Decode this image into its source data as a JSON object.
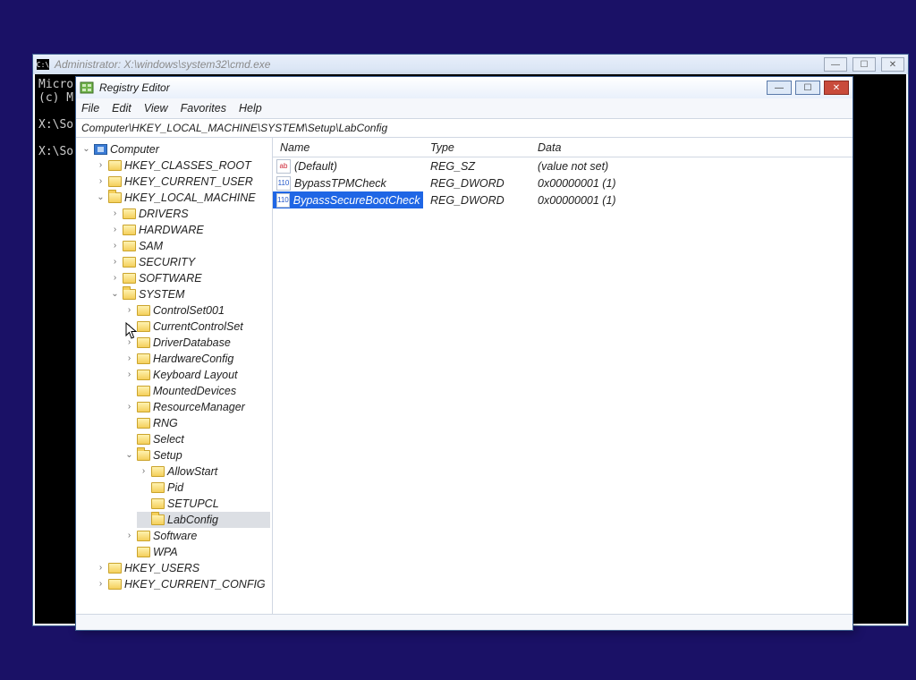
{
  "cmd": {
    "title": "Administrator: X:\\windows\\system32\\cmd.exe",
    "lines": [
      "Micro",
      "(c) M",
      "",
      "X:\\So",
      "",
      "X:\\So"
    ]
  },
  "regedit": {
    "title": "Registry Editor",
    "menu": {
      "file": "File",
      "edit": "Edit",
      "view": "View",
      "favorites": "Favorites",
      "help": "Help"
    },
    "address": "Computer\\HKEY_LOCAL_MACHINE\\SYSTEM\\Setup\\LabConfig",
    "columns": {
      "name": "Name",
      "type": "Type",
      "data": "Data"
    },
    "values": [
      {
        "icon": "str",
        "name": "(Default)",
        "type": "REG_SZ",
        "data": "(value not set)",
        "selected": false
      },
      {
        "icon": "num",
        "name": "BypassTPMCheck",
        "type": "REG_DWORD",
        "data": "0x00000001 (1)",
        "selected": false
      },
      {
        "icon": "num",
        "name": "BypassSecureBootCheck",
        "type": "REG_DWORD",
        "data": "0x00000001 (1)",
        "selected": true
      }
    ],
    "tree": {
      "root": "Computer",
      "keys": {
        "hkcr": "HKEY_CLASSES_ROOT",
        "hkcu": "HKEY_CURRENT_USER",
        "hklm": "HKEY_LOCAL_MACHINE",
        "drivers": "DRIVERS",
        "hardware": "HARDWARE",
        "sam": "SAM",
        "security": "SECURITY",
        "software": "SOFTWARE",
        "system": "SYSTEM",
        "cs001": "ControlSet001",
        "ccs": "CurrentControlSet",
        "drvdb": "DriverDatabase",
        "hwcfg": "HardwareConfig",
        "kbd": "Keyboard Layout",
        "mdev": "MountedDevices",
        "resmgr": "ResourceManager",
        "rng": "RNG",
        "select": "Select",
        "setup": "Setup",
        "allowstart": "AllowStart",
        "pid": "Pid",
        "setupcl": "SETUPCL",
        "labconfig": "LabConfig",
        "soft2": "Software",
        "wpa": "WPA",
        "hku": "HKEY_USERS",
        "hkcc": "HKEY_CURRENT_CONFIG"
      }
    }
  }
}
